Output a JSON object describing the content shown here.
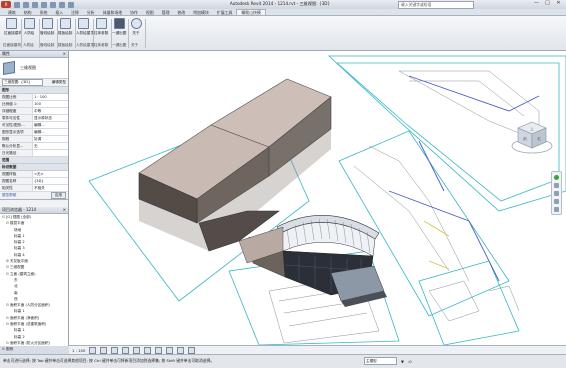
{
  "titlebar": {
    "app_menu": "R",
    "title": "Autodesk Revit 2014 -   1214.rvt - 三维视图: {3D}",
    "search_placeholder": "键入关键字或短语",
    "controls": [
      "—",
      "□",
      "✕"
    ]
  },
  "tabs": [
    "建筑",
    "结构",
    "系统",
    "插入",
    "注释",
    "分析",
    "体量和场地",
    "协作",
    "视图",
    "管理",
    "修改",
    "附加模块",
    "扩展工具",
    "橄榄山快模"
  ],
  "active_tab": "橄榄山快模",
  "ribbon": {
    "buttons": [
      {
        "label": "拉面接建构"
      },
      {
        "label": "人防绘"
      },
      {
        "label": "管线绘制"
      },
      {
        "label": "楼板绘制"
      },
      {
        "label": "人防绘屋顶"
      },
      {
        "label": "柱体参数"
      },
      {
        "label": "一键出图"
      },
      {
        "label": "关于"
      }
    ],
    "groups": [
      "拉面接建构",
      "人防绘",
      "管线绘制",
      "楼板绘制",
      "人防绘屋顶",
      "柱体参数",
      "一键出图",
      "关于"
    ]
  },
  "properties": {
    "title": "属性",
    "type_name": "三维视图",
    "selector": "三维视图: {3D}",
    "edit_type": "编辑类型",
    "group_graphics": "图形",
    "rows": [
      {
        "k": "视图比例",
        "v": "1 : 100"
      },
      {
        "k": "比例值 1:",
        "v": "100"
      },
      {
        "k": "详细程度",
        "v": "中等"
      },
      {
        "k": "零件可见性",
        "v": "显示原状态"
      },
      {
        "k": "可见性/图形...",
        "v": "编辑..."
      },
      {
        "k": "图形显示选项",
        "v": "编辑..."
      },
      {
        "k": "规程",
        "v": "协调"
      },
      {
        "k": "默认分析显...",
        "v": "无"
      },
      {
        "k": "日光路径",
        "v": ""
      }
    ],
    "group_range": "范围",
    "group_ident": "标识数据",
    "rows2": [
      {
        "k": "视图样板",
        "v": "<无>"
      },
      {
        "k": "视图名称",
        "v": "{3D}"
      },
      {
        "k": "相关性",
        "v": "不相关"
      }
    ],
    "help": "属性帮助",
    "apply": "应用"
  },
  "browser": {
    "title": "项目浏览器 - 1214",
    "nodes": [
      {
        "indent": 0,
        "tw": "⊟",
        "label": "[O] 视图 (全部)"
      },
      {
        "indent": 1,
        "tw": "⊟",
        "label": "楼层平面"
      },
      {
        "indent": 2,
        "tw": "",
        "label": "场地"
      },
      {
        "indent": 2,
        "tw": "",
        "label": "标高 1"
      },
      {
        "indent": 2,
        "tw": "",
        "label": "标高 2"
      },
      {
        "indent": 2,
        "tw": "",
        "label": "标高 3"
      },
      {
        "indent": 2,
        "tw": "",
        "label": "标高 4"
      },
      {
        "indent": 1,
        "tw": "⊞",
        "label": "天花板平面"
      },
      {
        "indent": 1,
        "tw": "⊟",
        "label": "三维视图"
      },
      {
        "indent": 1,
        "tw": "⊟",
        "label": "立面 (建筑立面)"
      },
      {
        "indent": 2,
        "tw": "",
        "label": "东"
      },
      {
        "indent": 2,
        "tw": "",
        "label": "北"
      },
      {
        "indent": 2,
        "tw": "",
        "label": "南"
      },
      {
        "indent": 2,
        "tw": "",
        "label": "西"
      },
      {
        "indent": 1,
        "tw": "⊟",
        "label": "面积平面 (人防分区面积)"
      },
      {
        "indent": 2,
        "tw": "",
        "label": "标高 1"
      },
      {
        "indent": 1,
        "tw": "⊟",
        "label": "面积平面 (净面积)"
      },
      {
        "indent": 1,
        "tw": "⊟",
        "label": "面积平面 (总建筑面积)"
      },
      {
        "indent": 2,
        "tw": "",
        "label": "标高 1"
      },
      {
        "indent": 2,
        "tw": "",
        "label": "标高 2"
      },
      {
        "indent": 1,
        "tw": "⊟",
        "label": "面积平面 (防火分区面积)"
      },
      {
        "indent": 0,
        "tw": "⊞",
        "label": "图例"
      }
    ]
  },
  "viewbar": {
    "scale": "1 : 100"
  },
  "status": {
    "text": "单击可进行选择; 按 Tab 键并单击可选择其他项目; 按 Ctrl 键并单击可将新项目添加到选择集; 按 Shift 键并单击可取消选择。",
    "model": "主模型",
    "filter": ":0"
  },
  "viewcube": {
    "top": "上",
    "front": "前",
    "right": "右"
  }
}
